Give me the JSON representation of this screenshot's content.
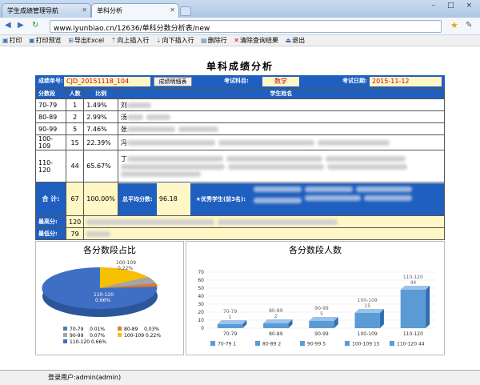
{
  "browser": {
    "tabs": [
      {
        "label": "学生成绩管理导航"
      },
      {
        "label": "单科分析"
      }
    ],
    "url": "www.iyunbiao.cn/12636/单科分数分析表/new",
    "window_controls": "– □ ×"
  },
  "toolbar": {
    "items": [
      {
        "label": "打印",
        "icon": "printer-icon"
      },
      {
        "label": "打印预览",
        "icon": "print-preview-icon"
      },
      {
        "label": "导出Excel",
        "icon": "excel-icon"
      },
      {
        "label": "向上插入行",
        "icon": "insert-up-icon"
      },
      {
        "label": "向下插入行",
        "icon": "insert-down-icon"
      },
      {
        "label": "删除行",
        "icon": "delete-row-icon"
      },
      {
        "label": "清除查询结果",
        "icon": "clear-icon"
      },
      {
        "label": "退出",
        "icon": "exit-icon"
      }
    ]
  },
  "report": {
    "title": "单科成绩分析",
    "form_no_label": "成绩单号:",
    "form_no": "CJD_20151118_104",
    "detail_button": "成绩明细表",
    "subject_label": "考试科目:",
    "subject": "数学",
    "date_label": "考试日期:",
    "date": "2015-11-12"
  },
  "table": {
    "headers": [
      "分数段",
      "人数",
      "比例",
      "学生姓名"
    ],
    "rows": [
      {
        "range": "70-79",
        "count": "1",
        "pct": "1.49%",
        "names": "刘"
      },
      {
        "range": "80-89",
        "count": "2",
        "pct": "2.99%",
        "names": "汤"
      },
      {
        "range": "90-99",
        "count": "5",
        "pct": "7.46%",
        "names": "张"
      },
      {
        "range": "100-109",
        "count": "15",
        "pct": "22.39%",
        "names": "冯"
      },
      {
        "range": "110-120",
        "count": "44",
        "pct": "65.67%",
        "names": "丁"
      }
    ],
    "total_label": "合 计:",
    "total_count": "67",
    "total_pct": "100.00%",
    "avg_label": "总平均分数:",
    "avg": "96.18",
    "top_label": "★优秀学生(前3名):",
    "max_label": "最高分:",
    "max": "120",
    "min_label": "最低分:",
    "min": "79"
  },
  "pie": {
    "title": "各分数段占比",
    "legend": [
      {
        "name": "70-79",
        "pct": "0.01%",
        "color": "#4a7ebb"
      },
      {
        "name": "80-89",
        "pct": "0.03%",
        "color": "#e07b2a"
      },
      {
        "name": "90-99",
        "pct": "0.07%",
        "color": "#a5a5a5"
      },
      {
        "name": "100-109",
        "pct": "0.22%",
        "color": "#f5c000"
      },
      {
        "name": "110-120",
        "pct": "0.66%",
        "color": "#3f6fc4"
      }
    ]
  },
  "chart_data": {
    "type": "bar",
    "title": "各分数段人数",
    "categories": [
      "70-79",
      "80-89",
      "90-99",
      "100-109",
      "110-120"
    ],
    "values": [
      1,
      2,
      5,
      15,
      44
    ],
    "ylim": [
      0,
      70
    ],
    "yticks": [
      0,
      10,
      20,
      30,
      40,
      50,
      60,
      70
    ],
    "color": "#5b9bd5"
  },
  "status": {
    "user": "登录用户:admin(admin)"
  }
}
